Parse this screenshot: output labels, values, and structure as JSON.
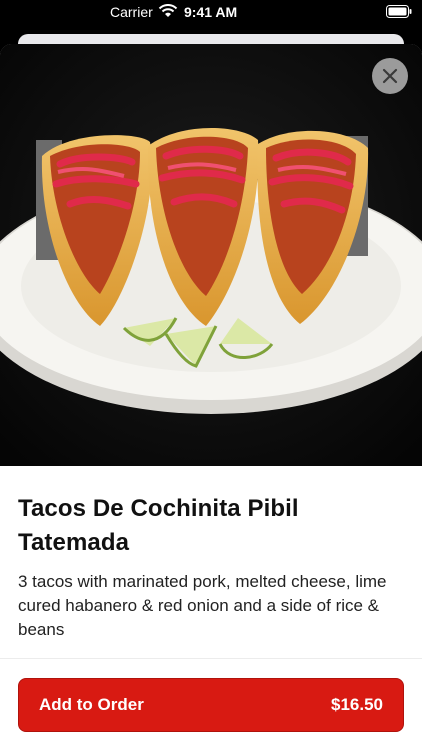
{
  "status_bar": {
    "carrier": "Carrier",
    "time": "9:41 AM",
    "icons": [
      "wifi-icon",
      "battery-icon"
    ]
  },
  "item": {
    "image_subject": "tacos-plate-photo",
    "title": "Tacos De Cochinita Pibil Tatemada",
    "description": "3 tacos with marinated pork, melted cheese, lime cured habanero & red onion and a side of rice & beans"
  },
  "actions": {
    "close_icon": "close-icon",
    "add_label": "Add to Order",
    "price": "$16.50"
  },
  "colors": {
    "accent": "#d81a12",
    "close_bg": "#9b9b9b"
  }
}
